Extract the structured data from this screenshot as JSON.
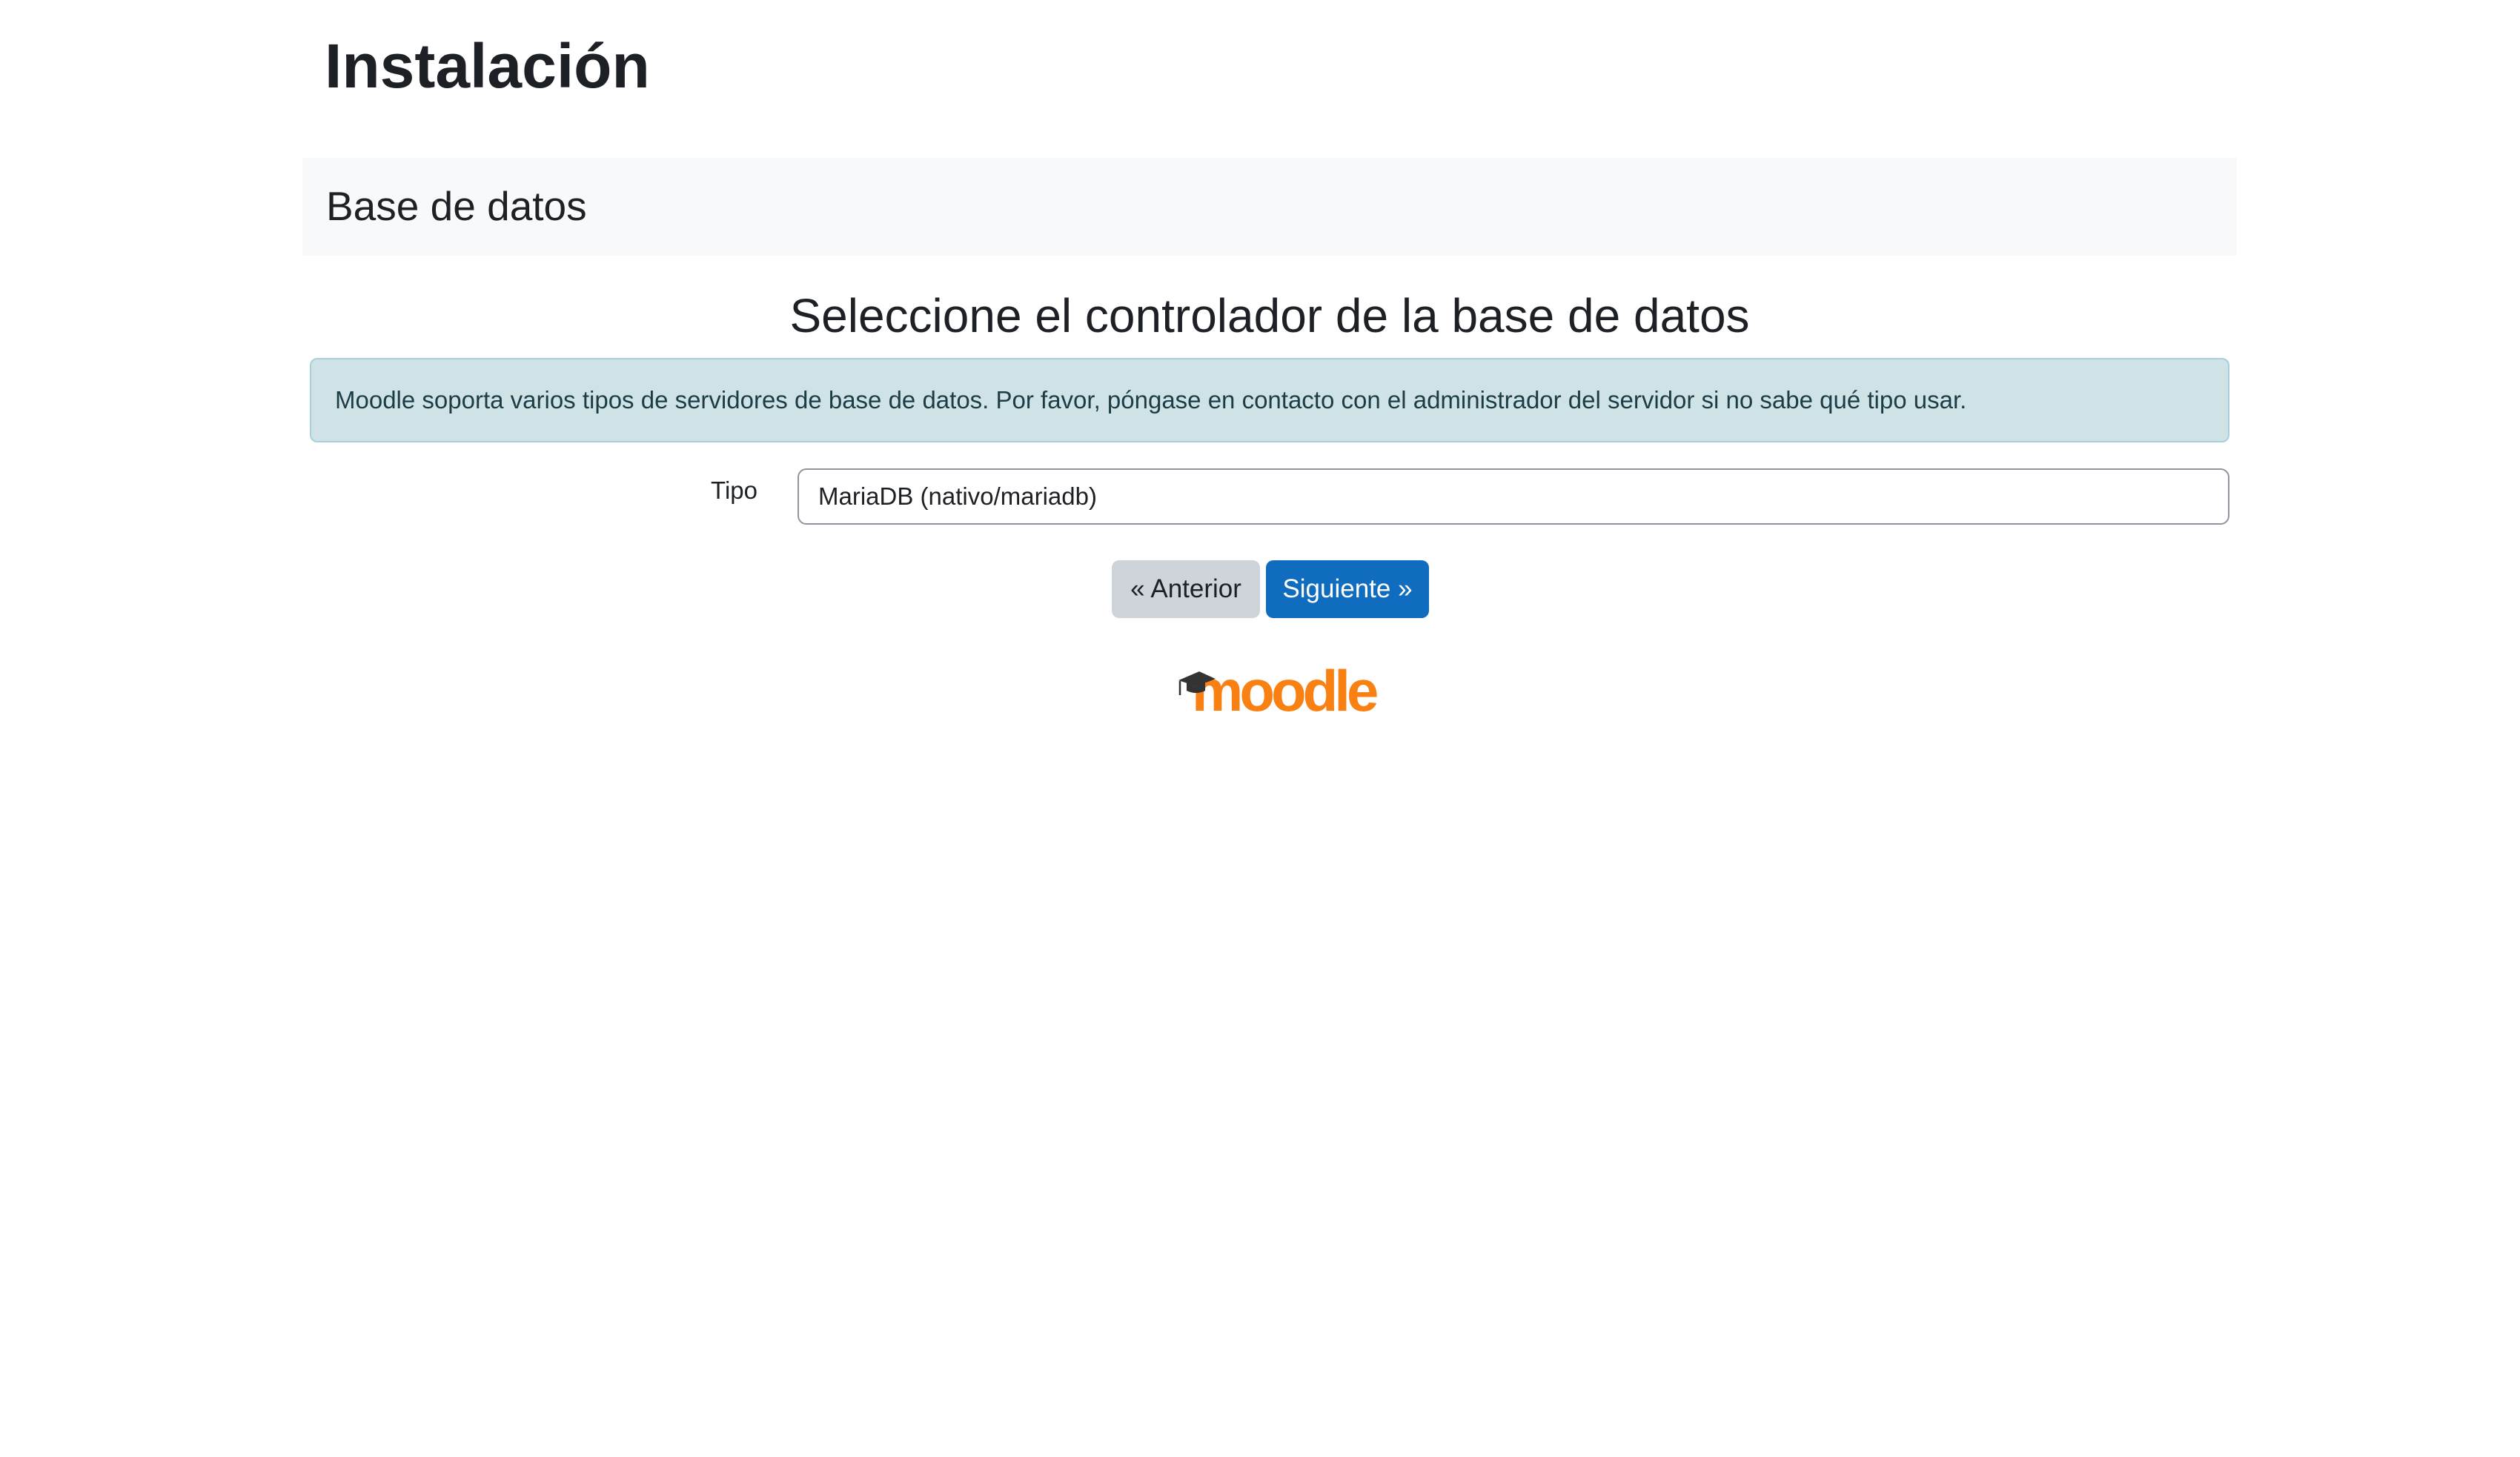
{
  "page": {
    "title": "Instalación",
    "stage": "Base de datos",
    "heading": "Seleccione el controlador de la base de datos",
    "info_message": "Moodle soporta varios tipos de servidores de base de datos. Por favor, póngase en contacto con el administrador del servidor si no sabe qué tipo usar."
  },
  "form": {
    "type_label": "Tipo",
    "type_value": "MariaDB (nativo/mariadb)"
  },
  "buttons": {
    "previous": "« Anterior",
    "next": "Siguiente »"
  },
  "logo": {
    "text": "moodle",
    "icon": "graduation-cap-icon"
  },
  "colors": {
    "primary": "#0f6cbf",
    "secondary": "#ced4da",
    "info_bg": "#cfe2e6",
    "logo_orange": "#f98012",
    "stage_bg": "#f8f9fa"
  }
}
